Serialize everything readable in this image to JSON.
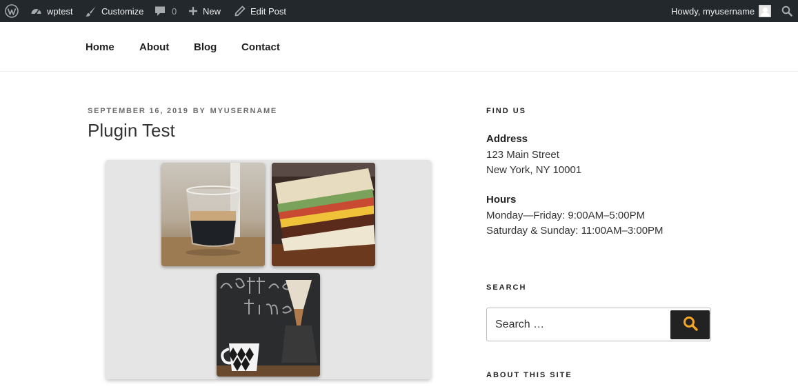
{
  "admin_bar": {
    "site_name": "wptest",
    "customize": "Customize",
    "comments_count": "0",
    "new": "New",
    "edit_post": "Edit Post",
    "howdy": "Howdy, myusername",
    "icons": [
      "wordpress-logo-icon",
      "dashboard-icon",
      "brush-icon",
      "comment-icon",
      "plus-icon",
      "pencil-icon",
      "avatar-icon",
      "search-icon"
    ]
  },
  "nav": {
    "items": [
      {
        "label": "Home"
      },
      {
        "label": "About"
      },
      {
        "label": "Blog"
      },
      {
        "label": "Contact"
      }
    ]
  },
  "post": {
    "date": "SEPTEMBER 16, 2019",
    "by": "BY",
    "author": "MYUSERNAME",
    "title": "Plugin Test",
    "gallery": [
      {
        "subject": "espresso glass"
      },
      {
        "subject": "sandwich"
      },
      {
        "subject": "coffee time chalkboard"
      }
    ]
  },
  "sidebar": {
    "find_us": {
      "title": "FIND US",
      "address_label": "Address",
      "address_line1": "123 Main Street",
      "address_line2": "New York, NY 10001",
      "hours_label": "Hours",
      "hours_line1": "Monday—Friday: 9:00AM–5:00PM",
      "hours_line2": "Saturday & Sunday: 11:00AM–3:00PM"
    },
    "search": {
      "title": "SEARCH",
      "placeholder": "Search …"
    },
    "about": {
      "title": "ABOUT THIS SITE"
    }
  },
  "colors": {
    "admin_bar_bg": "#23282d",
    "search_button_bg": "#222222",
    "search_icon": "#f5a623",
    "gallery_bg": "#e5e5e5"
  }
}
